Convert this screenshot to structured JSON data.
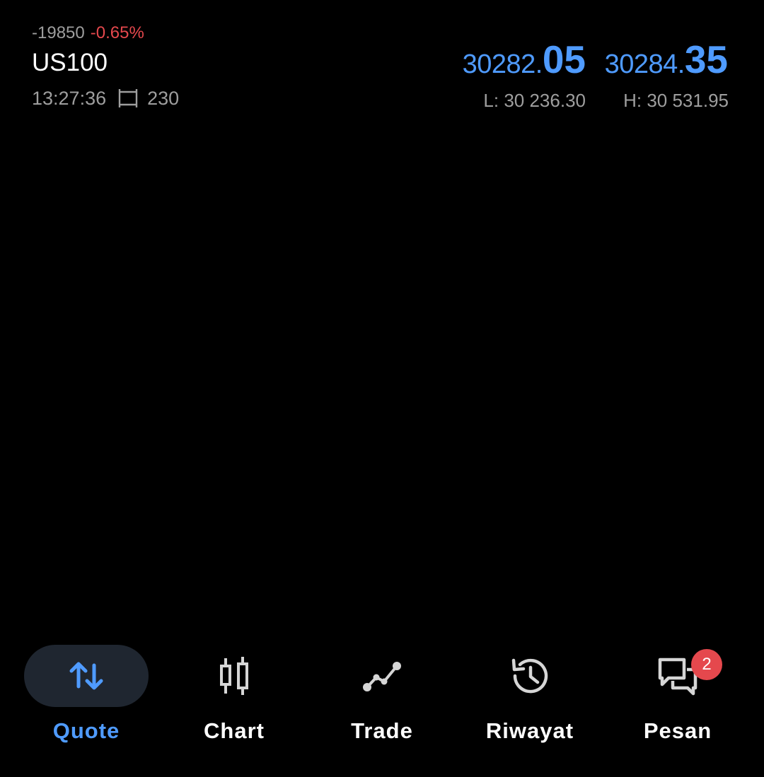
{
  "quote": {
    "change_points": "-19850",
    "change_percent": "-0.65%",
    "symbol": "US100",
    "time": "13:27:36",
    "spread": "230",
    "bid": {
      "prefix": "30282.",
      "suffix": "05"
    },
    "ask": {
      "prefix": "30284.",
      "suffix": "35"
    },
    "low": "L: 30 236.30",
    "high": "H: 30 531.95"
  },
  "nav": {
    "items": [
      {
        "label": "Quote",
        "icon": "arrows-up-down-icon",
        "active": true
      },
      {
        "label": "Chart",
        "icon": "candlestick-icon",
        "active": false
      },
      {
        "label": "Trade",
        "icon": "trend-line-icon",
        "active": false
      },
      {
        "label": "Riwayat",
        "icon": "history-icon",
        "active": false
      },
      {
        "label": "Pesan",
        "icon": "chat-icon",
        "active": false,
        "badge": "2"
      }
    ]
  },
  "colors": {
    "background": "#000000",
    "accent": "#4f9bff",
    "negative": "#e5484d",
    "muted": "#9e9e9e",
    "active_pill": "#1f2630"
  }
}
